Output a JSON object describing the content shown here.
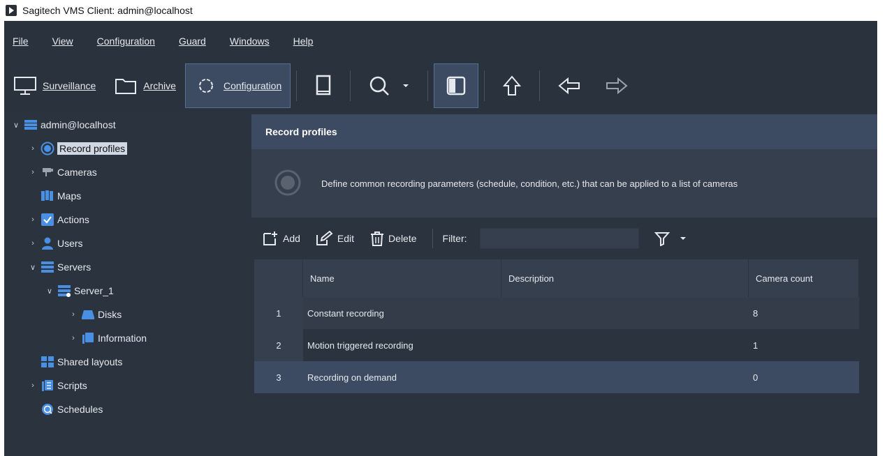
{
  "window": {
    "title": "Sagitech VMS Client: admin@localhost"
  },
  "menu": [
    {
      "label": "File"
    },
    {
      "label": "View"
    },
    {
      "label": "Configuration"
    },
    {
      "label": "Guard"
    },
    {
      "label": "Windows"
    },
    {
      "label": "Help"
    }
  ],
  "toolbar": {
    "surveillance": "Surveillance",
    "archive": "Archive",
    "configuration": "Configuration"
  },
  "tree": {
    "root": "admin@localhost",
    "items": [
      {
        "label": "Record profiles",
        "icon": "record-icon",
        "selected": true
      },
      {
        "label": "Cameras",
        "icon": "camera-icon"
      },
      {
        "label": "Maps",
        "icon": "map-icon"
      },
      {
        "label": "Actions",
        "icon": "checkbox-icon"
      },
      {
        "label": "Users",
        "icon": "user-icon"
      },
      {
        "label": "Servers",
        "icon": "servers-icon"
      },
      {
        "label": "Server_1",
        "icon": "server-icon"
      },
      {
        "label": "Disks",
        "icon": "disk-icon"
      },
      {
        "label": "Information",
        "icon": "info-icon"
      },
      {
        "label": "Shared layouts",
        "icon": "layout-icon"
      },
      {
        "label": "Scripts",
        "icon": "script-icon"
      },
      {
        "label": "Schedules",
        "icon": "schedule-icon"
      }
    ]
  },
  "panel": {
    "title": "Record profiles",
    "description": "Define common recording parameters (schedule, condition, etc.) that can be applied to a list of cameras"
  },
  "listbar": {
    "add": "Add",
    "edit": "Edit",
    "delete": "Delete",
    "filter_label": "Filter:",
    "filter_value": ""
  },
  "table": {
    "columns": [
      "Name",
      "Description",
      "Camera count"
    ],
    "rows": [
      {
        "num": "1",
        "name": "Constant recording",
        "description": "",
        "count": "8"
      },
      {
        "num": "2",
        "name": "Motion triggered recording",
        "description": "",
        "count": "1"
      },
      {
        "num": "3",
        "name": "Recording on demand",
        "description": "",
        "count": "0"
      }
    ]
  },
  "colors": {
    "window_bg": "#2b333f",
    "header_bg": "#3c4b62",
    "selection_bg": "#d0d8e4",
    "accent_blue": "#4a90e2"
  }
}
